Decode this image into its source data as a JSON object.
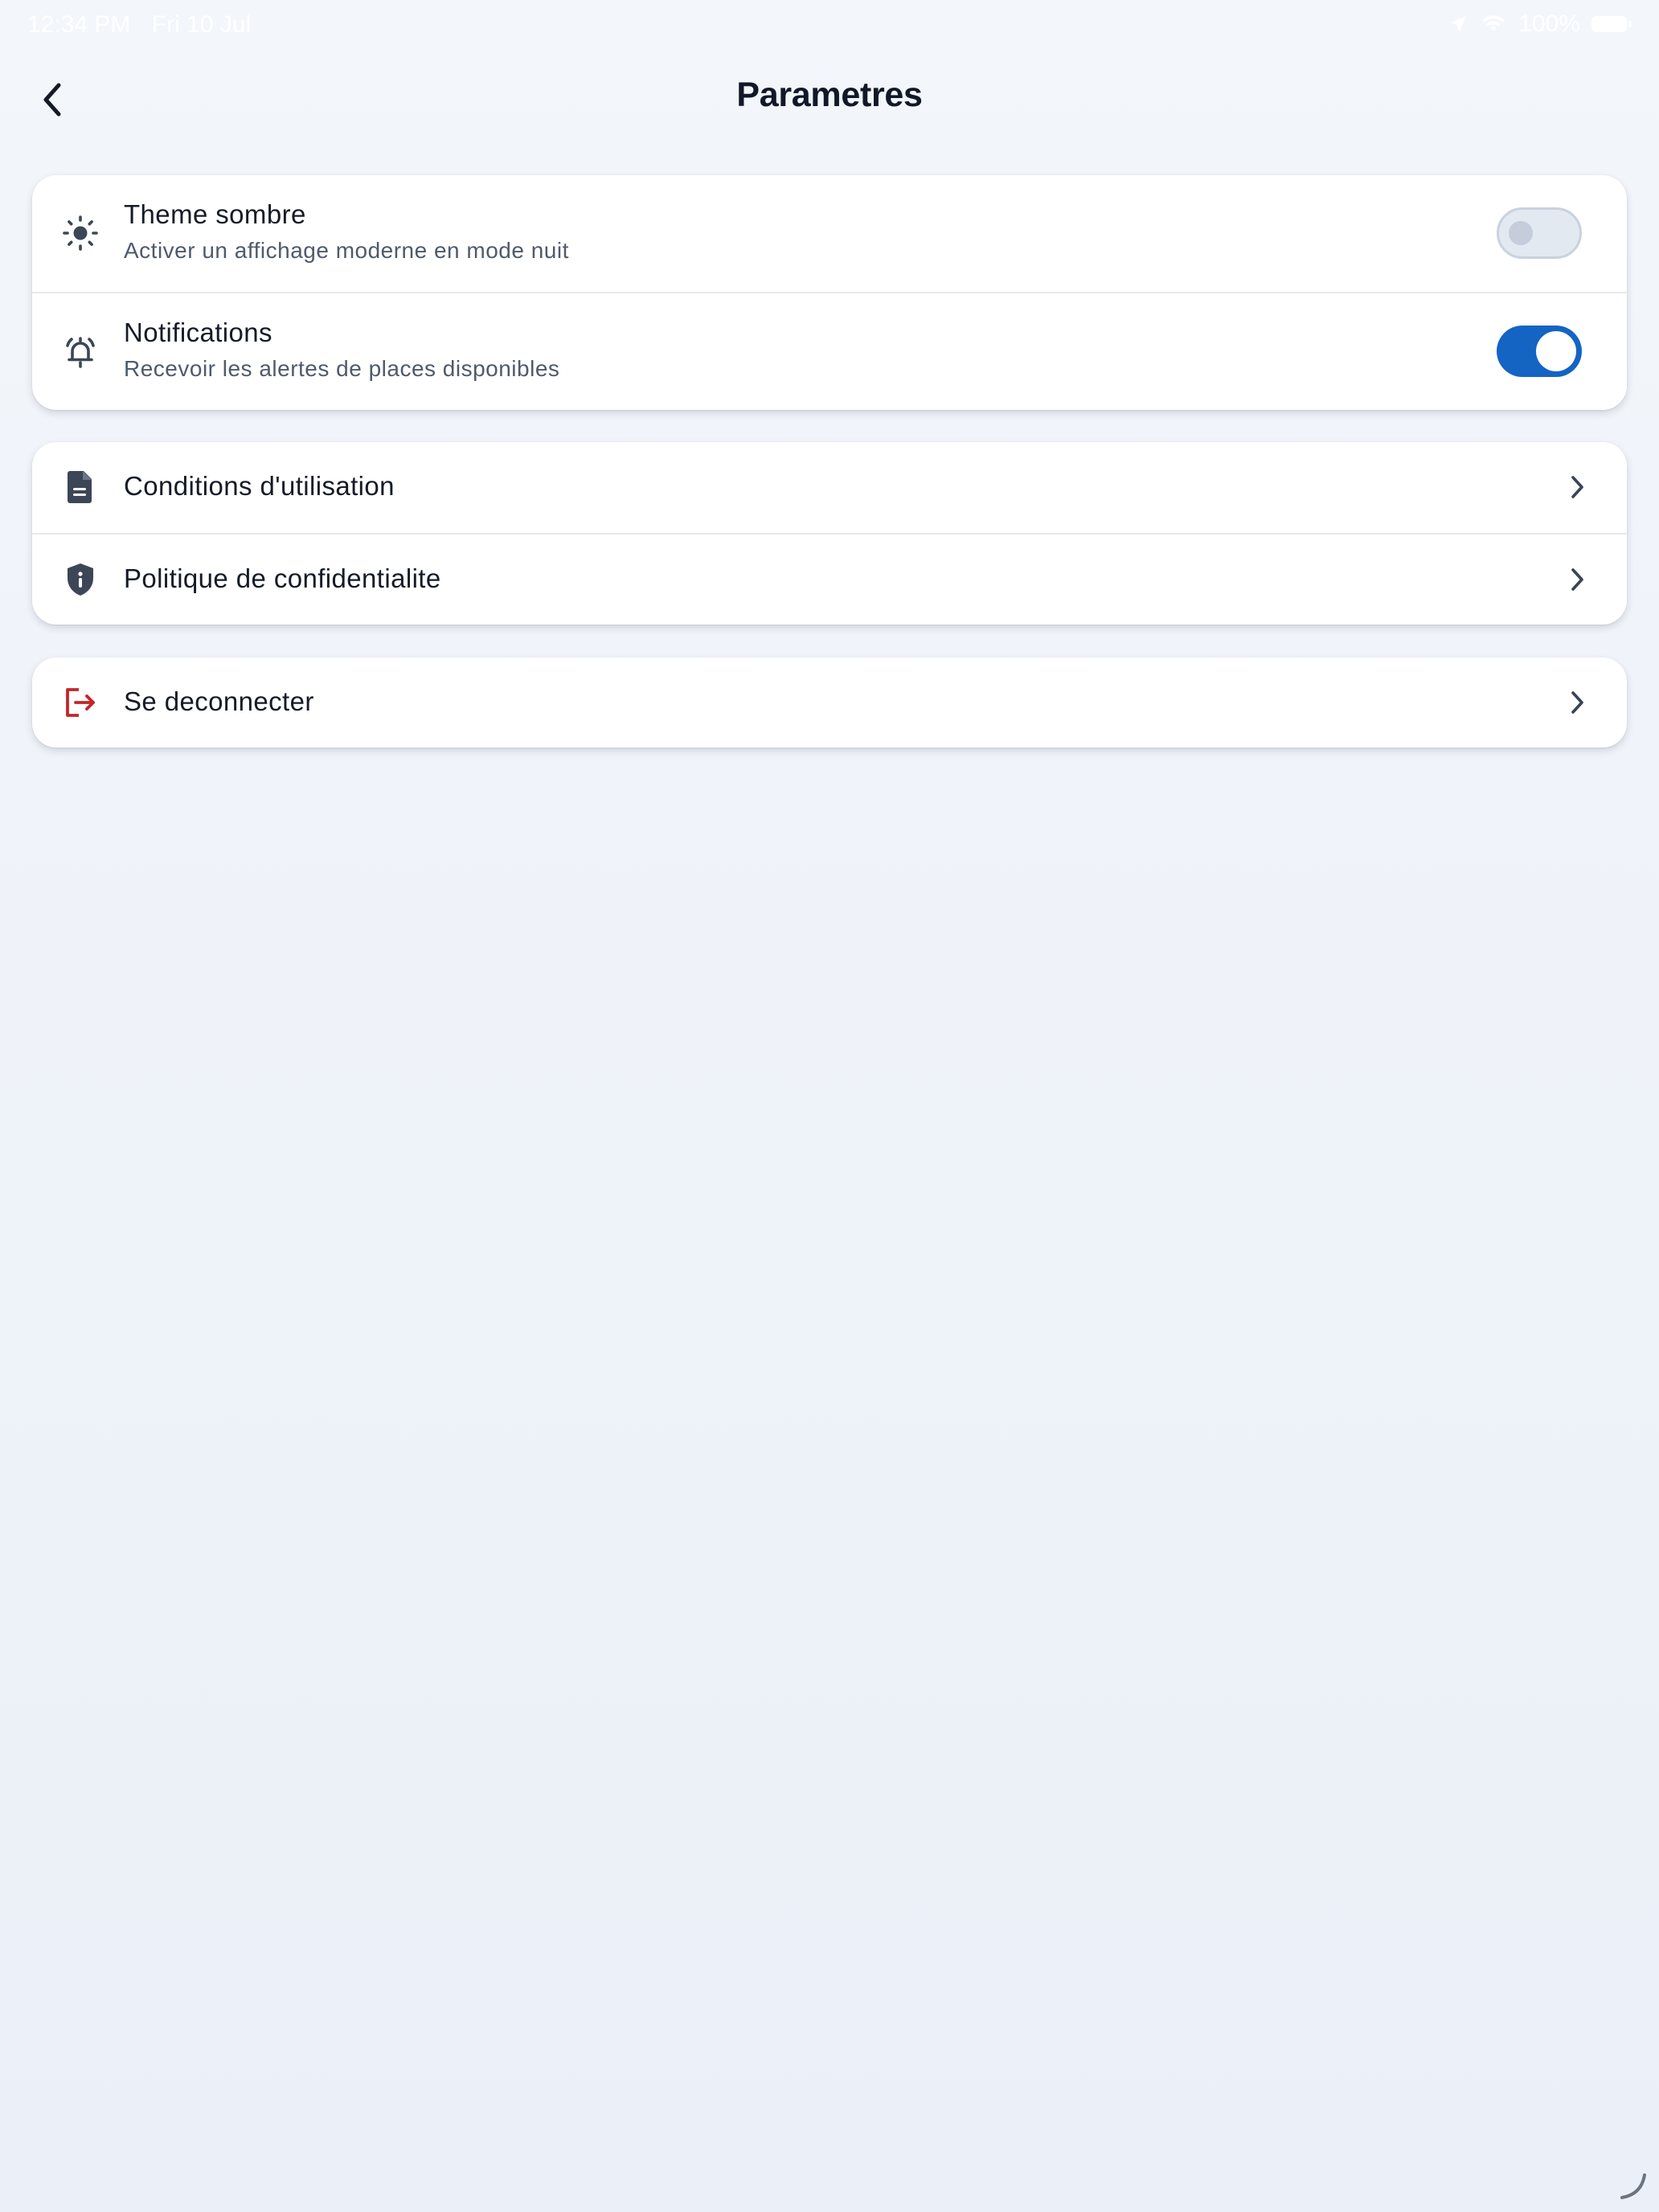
{
  "status_bar": {
    "time": "12:34 PM",
    "date": "Fri 10 Jul",
    "battery": "100%",
    "icons": [
      "location-arrow-icon",
      "wifi-icon",
      "battery-icon"
    ]
  },
  "header": {
    "back_icon": "chevron-left-icon",
    "title": "Parametres"
  },
  "settings": {
    "items": [
      {
        "icon": "sun-icon",
        "title": "Theme sombre",
        "subtitle": "Activer un affichage moderne en mode nuit",
        "enabled": false
      },
      {
        "icon": "alarm-bell-icon",
        "title": "Notifications",
        "subtitle": "Recevoir les alertes de places disponibles",
        "enabled": true
      }
    ]
  },
  "legal": {
    "items": [
      {
        "icon": "document-icon",
        "label": "Conditions d'utilisation"
      },
      {
        "icon": "shield-info-icon",
        "label": "Politique de confidentialite"
      }
    ]
  },
  "logout": {
    "icon": "logout-icon",
    "label": "Se deconnecter"
  },
  "colors": {
    "accent": "#1464c4",
    "danger": "#c2262a",
    "icon": "#4a5668",
    "background": "#eef2f9",
    "card": "#ffffff"
  }
}
